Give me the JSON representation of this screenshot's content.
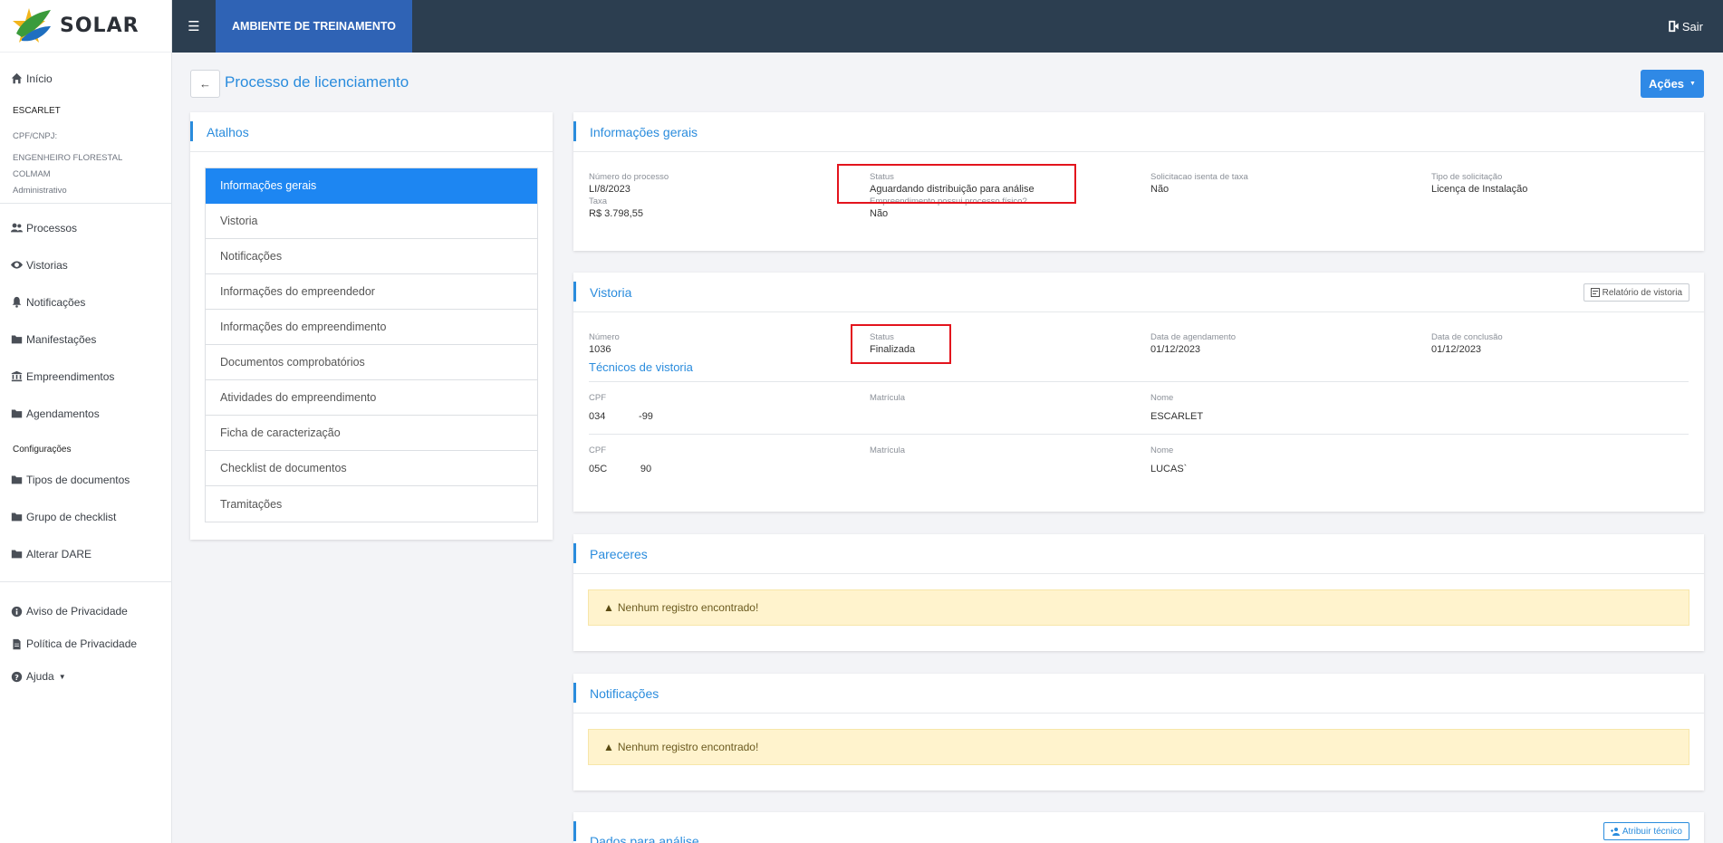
{
  "brand": {
    "name": "SOLAR"
  },
  "topbar": {
    "environment": "AMBIENTE DE TREINAMENTO",
    "logout_label": "Sair"
  },
  "sidebar": {
    "home": "Início",
    "user": {
      "name": "ESCARLET",
      "cpf_label": "CPF/CNPJ:",
      "role": "ENGENHEIRO FLORESTAL",
      "org": "COLMAM",
      "profile": "Administrativo"
    },
    "items": [
      {
        "label": "Processos",
        "icon": "users-icon"
      },
      {
        "label": "Vistorias",
        "icon": "eye-icon"
      },
      {
        "label": "Notificações",
        "icon": "bell-icon"
      },
      {
        "label": "Manifestações",
        "icon": "folder-icon"
      },
      {
        "label": "Empreendimentos",
        "icon": "institution-icon"
      },
      {
        "label": "Agendamentos",
        "icon": "folder-icon"
      }
    ],
    "config_label": "Configurações",
    "config_items": [
      {
        "label": "Tipos de documentos",
        "icon": "folder-icon"
      },
      {
        "label": "Grupo de checklist",
        "icon": "folder-icon"
      },
      {
        "label": "Alterar DARE",
        "icon": "folder-icon"
      }
    ],
    "footer_items": [
      {
        "label": "Aviso de Privacidade",
        "icon": "info-icon"
      },
      {
        "label": "Política de Privacidade",
        "icon": "document-icon"
      },
      {
        "label": "Ajuda",
        "icon": "help-icon"
      }
    ]
  },
  "page": {
    "title": "Processo de licenciamento",
    "actions_label": "Ações"
  },
  "shortcuts": {
    "title": "Atalhos",
    "items": [
      "Informações gerais",
      "Vistoria",
      "Notificações",
      "Informações do empreendedor",
      "Informações do empreendimento",
      "Documentos comprobatórios",
      "Atividades do empreendimento",
      "Ficha de caracterização",
      "Checklist de documentos",
      "Tramitações"
    ]
  },
  "general_info": {
    "title": "Informações gerais",
    "fields": [
      {
        "label": "Número do processo",
        "value": "LI/8/2023"
      },
      {
        "label": "Status",
        "value": "Aguardando distribuição para análise"
      },
      {
        "label": "Solicitacao isenta de taxa",
        "value": "Não"
      },
      {
        "label": "Tipo de solicitação",
        "value": "Licença de Instalação"
      },
      {
        "label": "Taxa",
        "value": "R$ 3.798,55"
      },
      {
        "label": "Empreendimento possui processo físico?",
        "value": "Não"
      }
    ]
  },
  "inspection": {
    "title": "Vistoria",
    "report_button": "Relatório de vistoria",
    "fields": [
      {
        "label": "Número",
        "value": "1036"
      },
      {
        "label": "Status",
        "value": "Finalizada"
      },
      {
        "label": "Data de agendamento",
        "value": "01/12/2023"
      },
      {
        "label": "Data de conclusão",
        "value": "01/12/2023"
      }
    ],
    "technicians_title": "Técnicos de vistoria",
    "technicians": [
      {
        "cpf_label": "CPF",
        "cpf": "034            -99",
        "reg_label": "Matrícula",
        "reg": "",
        "name_label": "Nome",
        "name": "ESCARLET"
      },
      {
        "cpf_label": "CPF",
        "cpf": "05C            90",
        "reg_label": "Matrícula",
        "reg": "",
        "name_label": "Nome",
        "name": "LUCAS`"
      }
    ]
  },
  "opinions": {
    "title": "Pareceres",
    "empty": "Nenhum registro encontrado!"
  },
  "notifications": {
    "title": "Notificações",
    "empty": "Nenhum registro encontrado!"
  },
  "analysis": {
    "title": "Dados para análise",
    "assign_button": "Atribuir técnico"
  },
  "colors": {
    "accent": "#2a8cdd",
    "topbar": "#2c3e50",
    "env": "#2f63b5",
    "active": "#1d86f2",
    "highlight": "#e3141d",
    "alert_bg": "#fff3cd"
  }
}
